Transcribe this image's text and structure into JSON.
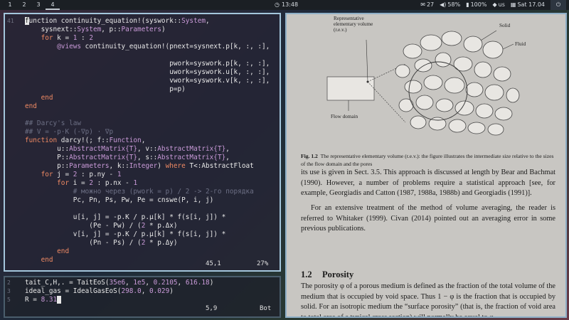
{
  "topbar": {
    "workspaces": [
      "1",
      "2",
      "3",
      "4"
    ],
    "clock": "13:48",
    "tray": {
      "notifications": "27",
      "volume": "58%",
      "battery": "100%",
      "network": "us",
      "date": "Sat 17.04"
    },
    "icons": {
      "clock": "clock-icon",
      "notifications": "bell-icon",
      "volume": "speaker-icon",
      "battery": "battery-icon",
      "network": "wifi-icon",
      "calendar": "calendar-icon",
      "power": "power-icon"
    }
  },
  "editor_main": {
    "lines": [
      {
        "n": "41",
        "code": "function continuity_equation!(syswork::System,"
      },
      {
        "n": "",
        "code": "    sysnext::System, p::Parameters)"
      },
      {
        "n": "",
        "code": "    for k = 1 : 2"
      },
      {
        "n": "",
        "code": "        @views continuity_equation!(pnext=sysnext.p[k, :, :],"
      },
      {
        "n": "",
        "code": ""
      },
      {
        "n": "",
        "code": "                                    pwork=syswork.p[k, :, :],"
      },
      {
        "n": "",
        "code": "                                    uwork=syswork.u[k, :, :],"
      },
      {
        "n": "",
        "code": "                                    vwork=syswork.v[k, :, :],"
      },
      {
        "n": "",
        "code": "                                    p=p)"
      },
      {
        "n": "",
        "code": "    end"
      },
      {
        "n": "",
        "code": "end"
      },
      {
        "n": "",
        "code": ""
      },
      {
        "n": "",
        "code": "## Darcy's law"
      },
      {
        "n": "",
        "code": "## V = -p·K (-∇p) · ∇p"
      },
      {
        "n": "",
        "code": "function darcy!(; f::Function,"
      },
      {
        "n": "",
        "code": "        u::AbstractMatrix{T}, v::AbstractMatrix{T},"
      },
      {
        "n": "",
        "code": "        P::AbstractMatrix{T}, s::AbstractMatrix{T},"
      },
      {
        "n": "",
        "code": "        p::Parameters, k::Integer) where T<:AbstractFloat"
      },
      {
        "n": "",
        "code": "    for j = 2 : p.ny - 1"
      },
      {
        "n": "",
        "code": "        for i = 2 : p.nx - 1"
      },
      {
        "n": "",
        "code": "            # можно через (pwork = p) / 2 -> 2-го порядка"
      },
      {
        "n": "",
        "code": "            Pc, Pn, Ps, Pw, Pe = cnswe(P, i, j)"
      },
      {
        "n": "",
        "code": ""
      },
      {
        "n": "",
        "code": "            u[i, j] = -p.K / p.μ[k] * f(s[i, j]) *"
      },
      {
        "n": "",
        "code": "                (Pe - Pw) / (2 * p.Δx)"
      },
      {
        "n": "",
        "code": "            v[i, j] = -p.K / p.μ[k] * f(s[i, j]) *"
      },
      {
        "n": "",
        "code": "                (Pn - Ps) / (2 * p.Δy)"
      },
      {
        "n": "",
        "code": "        end"
      },
      {
        "n": "",
        "code": "    end"
      }
    ],
    "status_position": "45,1",
    "status_percent": "27%"
  },
  "editor_small": {
    "lines": [
      {
        "n": "2",
        "code": "tait_C,H,. = TaitEoS(35e6, 1e5, 0.2105, 616.18)"
      },
      {
        "n": "3",
        "code": "ideal_gas = IdealGasEoS(298.0, 0.029)"
      },
      {
        "n": "5",
        "code": "R = 8.31"
      }
    ],
    "status_position": "5,9",
    "status_percent": "Bot"
  },
  "pdf": {
    "figure_labels": {
      "rev": "Representative elementary volume (r.e.v.)",
      "solid": "Solid",
      "fluid": "Fluid",
      "flow_domain": "Flow domain"
    },
    "caption_prefix": "Fig. 1.2",
    "caption_text": "The representative elementary volume (r.e.v.): the figure illustrates the intermediate size relative to the sizes of the flow domain and the pores",
    "para1": "its use is given in Sect. 3.5. This approach is discussed at length by Bear and Bachmat (1990). However, a number of problems require a statistical approach [see, for example, Georgiadis and Catton (1987, 1988a, 1988b) and Georgiadis (1991)].",
    "para2": "For an extensive treatment of the method of volume averaging, the reader is referred to Whitaker (1999). Civan (2014) pointed out an averaging error in some previous publications.",
    "section_number": "1.2",
    "section_title": "Porosity",
    "para3": "The porosity φ of a porous medium is defined as the fraction of the total volume of the medium that is occupied by void space. Thus 1 − φ is the fraction that is occupied by solid. For an isotropic medium the “surface porosity” (that is, the fraction of void area to total area of a typical cross section) will normally be equal to φ."
  }
}
